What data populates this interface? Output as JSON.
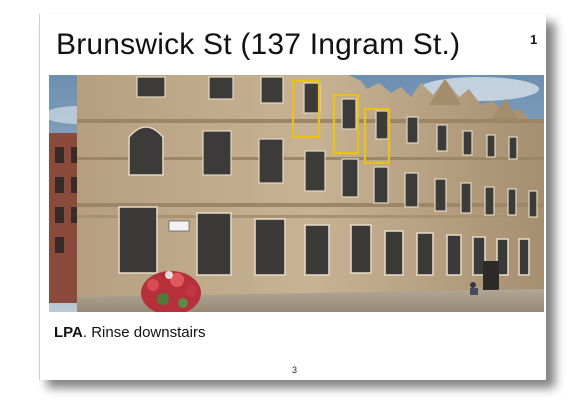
{
  "slide": {
    "title": "Brunswick St (137 Ingram St.)",
    "corner_number": "1",
    "caption_bold": "LPA",
    "caption_rest": ". Rinse downstairs",
    "page_number": "3"
  },
  "photo": {
    "highlight_color": "#e8c21a",
    "highlighted_windows": 3
  }
}
